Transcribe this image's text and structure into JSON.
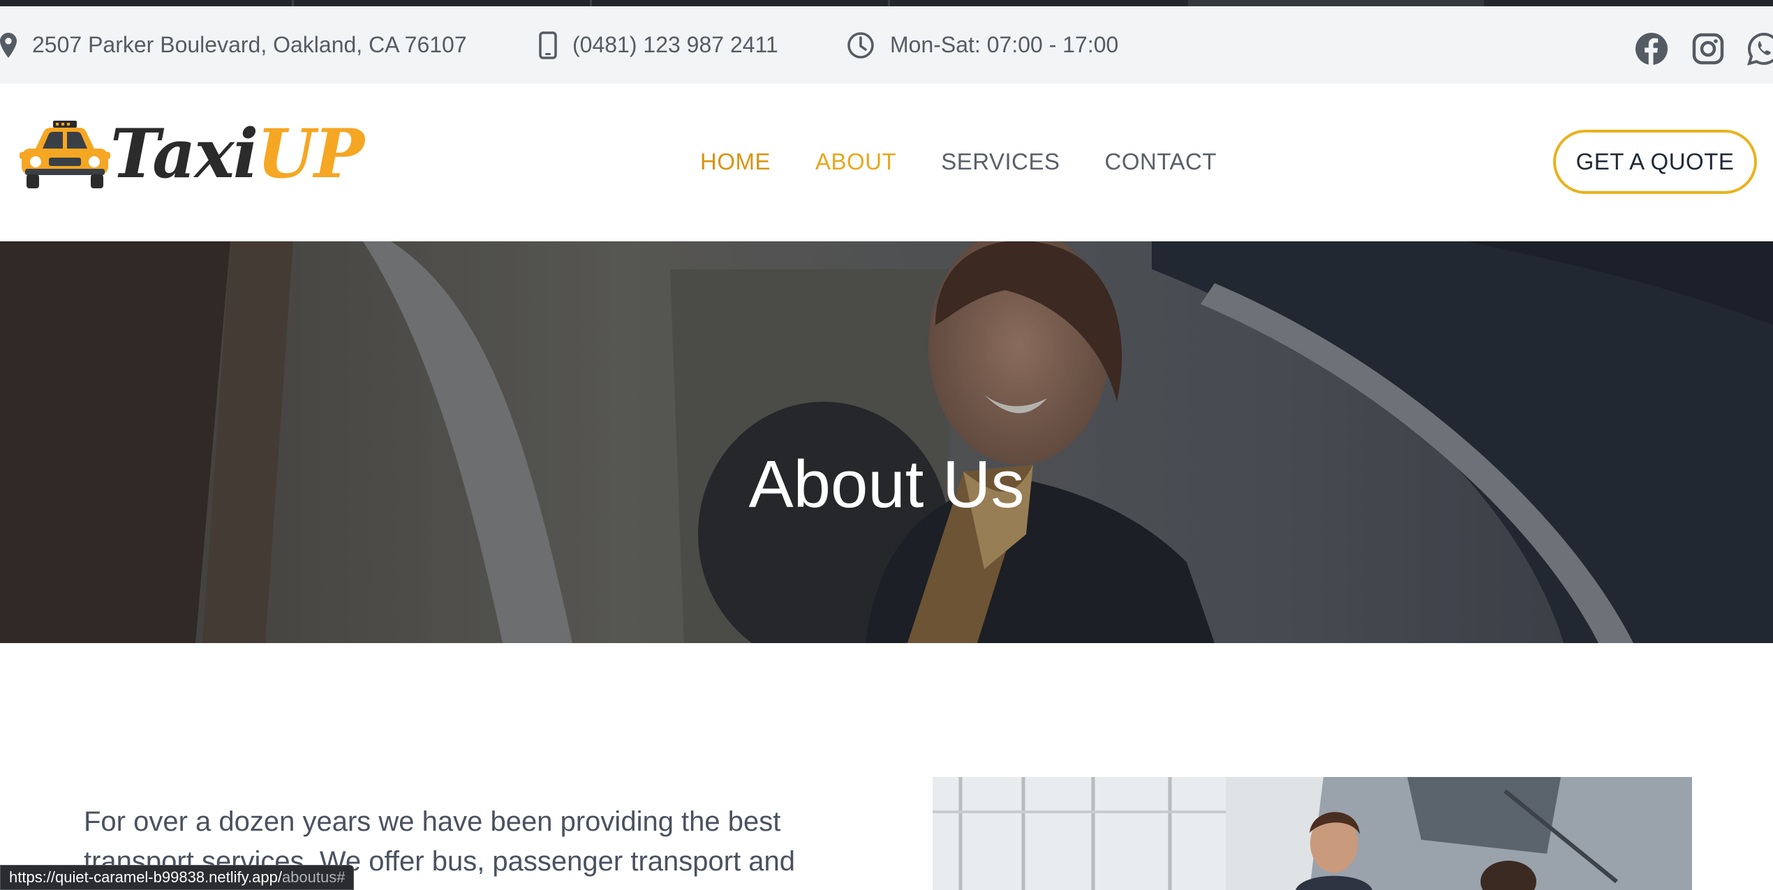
{
  "topbar": {
    "address": "2507 Parker Boulevard, Oakland, CA 76107",
    "phone": "(0481) 123 987 2411",
    "hours": "Mon-Sat: 07:00 - 17:00",
    "social_icons": [
      "facebook-icon",
      "instagram-icon",
      "whatsapp-icon"
    ]
  },
  "brand": {
    "logo_part1": "Taxi",
    "logo_part2": "UP",
    "accent_color": "#f5a623"
  },
  "nav": {
    "items": [
      {
        "label": "HOME"
      },
      {
        "label": "ABOUT"
      },
      {
        "label": "SERVICES"
      },
      {
        "label": "CONTACT"
      }
    ],
    "cta_label": "GET A QUOTE"
  },
  "hero": {
    "title": "About Us"
  },
  "intro": {
    "text": "For over a dozen years we have been providing the best transport services. We offer bus, passenger transport and"
  },
  "status_bar": {
    "url_main": "https://quiet-caramel-b99838.netlify.app/",
    "url_rest": "aboutus#"
  }
}
